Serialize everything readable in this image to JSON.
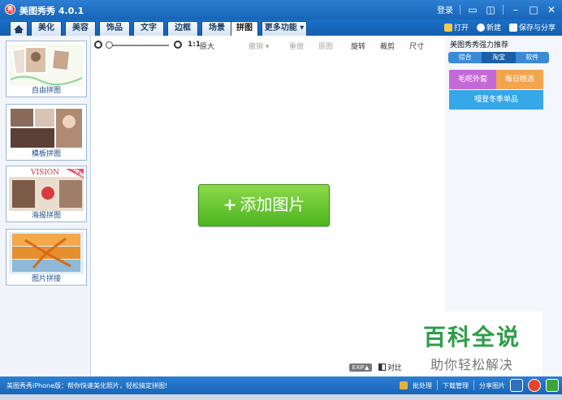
{
  "titlebar": {
    "title": "美图秀秀 4.0.1",
    "logo": "秀",
    "login": "登录",
    "controls": [
      "message-icon",
      "skin-icon",
      "minimize-icon",
      "maximize-icon",
      "close-icon"
    ]
  },
  "tabs": [
    {
      "label": "美化"
    },
    {
      "label": "美容"
    },
    {
      "label": "饰品"
    },
    {
      "label": "文字"
    },
    {
      "label": "边框"
    },
    {
      "label": "场景"
    },
    {
      "label": "拼图",
      "active": true
    },
    {
      "label": "更多功能 ▾"
    }
  ],
  "tab_actions": {
    "open": "打开",
    "new": "新建",
    "save": "保存与分享"
  },
  "toolbar": {
    "zoom_ratio": "1:1",
    "zoom_original": "原大",
    "undo": "撤销 ▾",
    "redo": "重做",
    "reset": "原图",
    "rotate": "旋转",
    "crop": "裁剪",
    "size": "尺寸"
  },
  "left_panel": {
    "items": [
      {
        "label": "自由拼图"
      },
      {
        "label": "模板拼图"
      },
      {
        "label": "海报拼图",
        "badge": "new",
        "caption": "VISION"
      },
      {
        "label": "图片拼接"
      }
    ]
  },
  "canvas": {
    "add_button": "添加图片",
    "exif": "EXIF▲",
    "compare": "对比"
  },
  "right_panel": {
    "title": "美图秀秀强力推荐",
    "tabs": [
      "综合",
      "淘宝",
      "软件"
    ],
    "active_tab": "淘宝",
    "ads": [
      "毛呢外套",
      "每日精选",
      "嘎登冬季单品"
    ]
  },
  "watermark": {
    "main": "百科全说",
    "sub": "助你轻松解决"
  },
  "statusbar": {
    "tip": "美图秀秀iPhone版：帮你快速美化照片，轻松搞定拼图!",
    "batch": "批处理",
    "download": "下载管理",
    "share": "分享图片"
  }
}
